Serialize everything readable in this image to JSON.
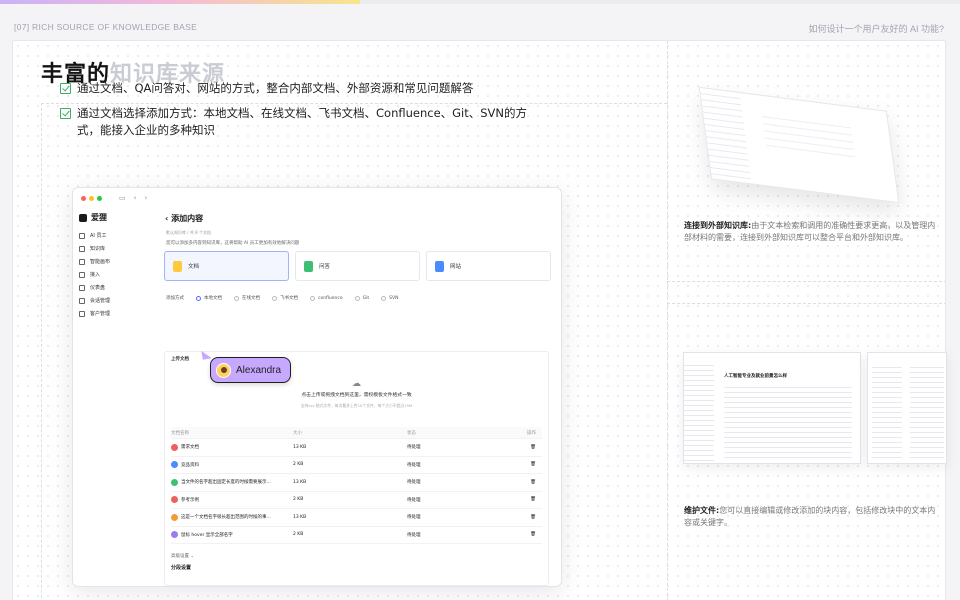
{
  "header": {
    "section": "[07] RICH SOURCE OF KNOWLEDGE BASE",
    "question": "如何设计一个用户友好的 AI 功能?"
  },
  "title": {
    "strong": "丰富的",
    "light": "知识库来源"
  },
  "bullets": [
    "通过文档、QA问答对、网站的方式，整合内部文档、外部资源和常见问题解答",
    "通过文档选择添加方式：本地文档、在线文档、飞书文档、Confluence、Git、SVN的方式，能接入企业的多种知识"
  ],
  "mock": {
    "brand": "爱狸",
    "nav": [
      "AI 员工",
      "知识库",
      "智能画布",
      "接入",
      "仪表盘",
      "会话管理",
      "客户管理"
    ],
    "page_title": "添加内容",
    "breadcrumb": "默认知识库 / 共 8 个文档",
    "description": "您可以添加多内容到知识库，这将帮助 AI 员工更加有效地解决问题",
    "types": [
      "文档",
      "问答",
      "网站"
    ],
    "method_label": "添加方式",
    "methods": [
      "本地文档",
      "在线文档",
      "飞书文档",
      "confluence",
      "Git",
      "SVN"
    ],
    "upload_label": "上传文档",
    "drop_title": "点击上传或拖拽文档到这里，需权模板文件格式一致",
    "drop_hint": "支持csv 格式文件，每次最多上传10个文件，每个大小不超过15M",
    "columns": [
      "文档名称",
      "大小",
      "状态",
      "操作"
    ],
    "rows": [
      {
        "name": "需求文档",
        "size": "13 KB",
        "status": "待处理"
      },
      {
        "name": "竞品资料",
        "size": "2 KB",
        "status": "待处理"
      },
      {
        "name": "当文件的名字超出固定长度的时候需要展示...",
        "size": "13 KB",
        "status": "待处理"
      },
      {
        "name": "参考示例",
        "size": "2 KB",
        "status": "待处理"
      },
      {
        "name": "这是一个文档名字很长超出范围的时候的事...",
        "size": "13 KB",
        "status": "待处理"
      },
      {
        "name": "鼠标 hover 显示全部名字",
        "size": "2 KB",
        "status": "待处理"
      }
    ],
    "advanced": "高级设置 ⌄",
    "segment": "分段设置",
    "cursor_user": "Alexandra"
  },
  "right": {
    "block1_title": "连接到外部知识库:",
    "block1_text": "由于文本检索和调用的准确性要求更高，以及管理内部材料的需要，连接到外部知识库可以整合平台和外部知识库。",
    "block2_title": "维护文件:",
    "block2_text": "您可以直接编辑或修改添加的块内容，包括修改块中的文本内容或关键字。",
    "doc_heading": "人工智能专业及就业前景怎么样"
  },
  "colors": {
    "accent_green": "#3fae6a",
    "accent_purple": "#c7a8ff",
    "accent_blue": "#5b6cff"
  }
}
